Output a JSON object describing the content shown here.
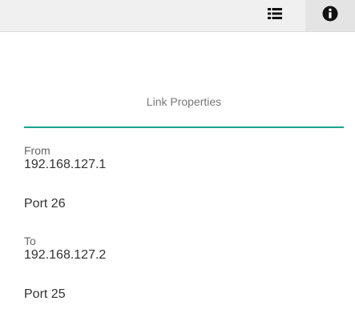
{
  "toolbar": {
    "list_icon": "list-icon",
    "info_icon": "info-icon"
  },
  "panel": {
    "title": "Link Properties",
    "accent_color": "#1ba58f",
    "from": {
      "label": "From",
      "address": "192.168.127.1",
      "port": "Port 26"
    },
    "to": {
      "label": "To",
      "address": "192.168.127.2",
      "port": "Port 25"
    }
  }
}
